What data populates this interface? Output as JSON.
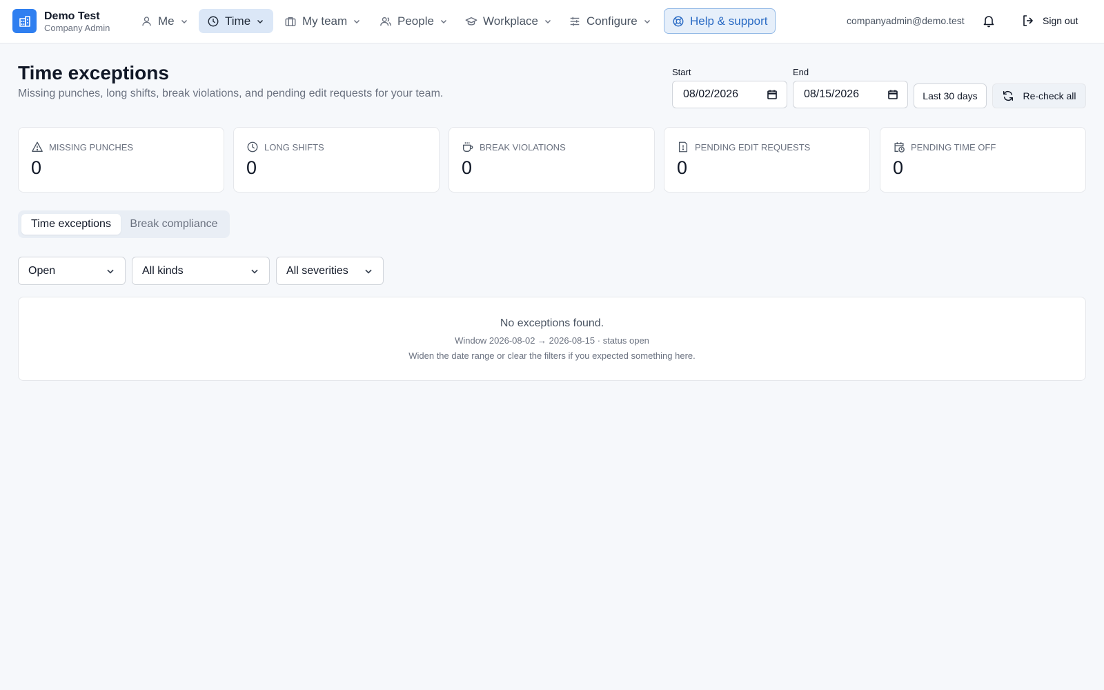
{
  "brand": {
    "name": "Demo Test",
    "role": "Company Admin"
  },
  "nav": {
    "me": "Me",
    "time": "Time",
    "my_team": "My team",
    "people": "People",
    "workplace": "Workplace",
    "configure": "Configure",
    "help": "Help & support",
    "active_item": "Time"
  },
  "user": {
    "email": "companyadmin@demo.test",
    "sign_out": "Sign out"
  },
  "header": {
    "title": "Time exceptions",
    "subtitle": "Missing punches, long shifts, break violations, and pending edit requests for your team."
  },
  "date_range": {
    "start_label": "Start",
    "start_value": "08/02/2026",
    "end_label": "End",
    "end_value": "08/15/2026",
    "preset_button": "Last 30 days",
    "recheck_button": "Re-check all"
  },
  "stats": [
    {
      "label": "MISSING PUNCHES",
      "value": "0",
      "icon": "warning-icon"
    },
    {
      "label": "LONG SHIFTS",
      "value": "0",
      "icon": "clock-icon"
    },
    {
      "label": "BREAK VIOLATIONS",
      "value": "0",
      "icon": "coffee-icon"
    },
    {
      "label": "PENDING EDIT REQUESTS",
      "value": "0",
      "icon": "alert-document-icon"
    },
    {
      "label": "PENDING TIME OFF",
      "value": "0",
      "icon": "calendar-clock-icon"
    }
  ],
  "tabs": {
    "active": "Time exceptions",
    "inactive": "Break compliance"
  },
  "filters": {
    "status": "Open",
    "kind": "All kinds",
    "severity": "All severities"
  },
  "empty_state": {
    "title": "No exceptions found.",
    "window": "Window 2026-08-02 → 2026-08-15 · status open",
    "hint": "Widen the date range or clear the filters if you expected something here."
  },
  "colors": {
    "accent": "#2f7ff0",
    "help_text": "#2a6bc4",
    "active_nav_bg": "#dbe7f7",
    "page_bg": "#f6f8fb"
  }
}
